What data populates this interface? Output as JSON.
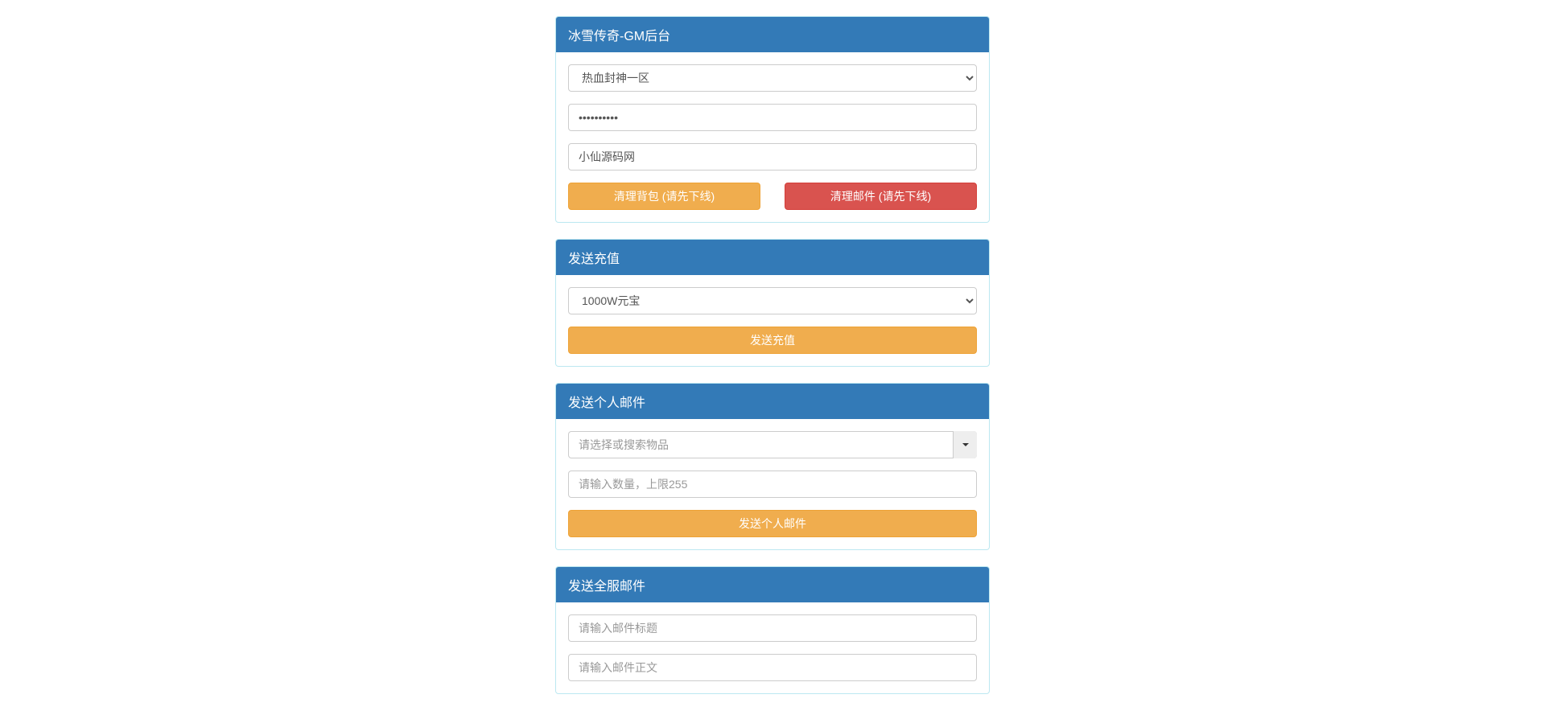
{
  "panel1": {
    "title": "冰雪传奇-GM后台",
    "server_select": "热血封神一区",
    "password_value": "••••••••••",
    "player_name": "小仙源码网",
    "clear_bag_label": "清理背包 (请先下线)",
    "clear_mail_label": "清理邮件 (请先下线)"
  },
  "panel2": {
    "title": "发送充值",
    "recharge_select": "1000W元宝",
    "send_label": "发送充值"
  },
  "panel3": {
    "title": "发送个人邮件",
    "item_placeholder": "请选择或搜索物品",
    "quantity_placeholder": "请输入数量，上限255",
    "send_label": "发送个人邮件"
  },
  "panel4": {
    "title": "发送全服邮件",
    "subject_placeholder": "请输入邮件标题",
    "body_placeholder": "请输入邮件正文"
  }
}
